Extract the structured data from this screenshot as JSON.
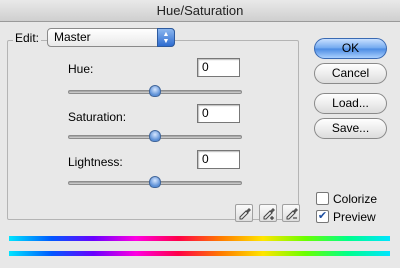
{
  "window": {
    "title": "Hue/Saturation"
  },
  "edit": {
    "label": "Edit:",
    "value": "Master"
  },
  "params": {
    "hue": {
      "label": "Hue:",
      "value": "0",
      "slider_fraction": 0.5
    },
    "saturation": {
      "label": "Saturation:",
      "value": "0",
      "slider_fraction": 0.5
    },
    "lightness": {
      "label": "Lightness:",
      "value": "0",
      "slider_fraction": 0.5
    }
  },
  "buttons": {
    "ok": "OK",
    "cancel": "Cancel",
    "load": "Load...",
    "save": "Save..."
  },
  "options": {
    "colorize": {
      "label": "Colorize",
      "checked": false
    },
    "preview": {
      "label": "Preview",
      "checked": true
    }
  },
  "icons": [
    "eyedropper-icon",
    "eyedropper-plus-icon",
    "eyedropper-minus-icon"
  ],
  "colors": {
    "accent": "#4a8ae3"
  }
}
